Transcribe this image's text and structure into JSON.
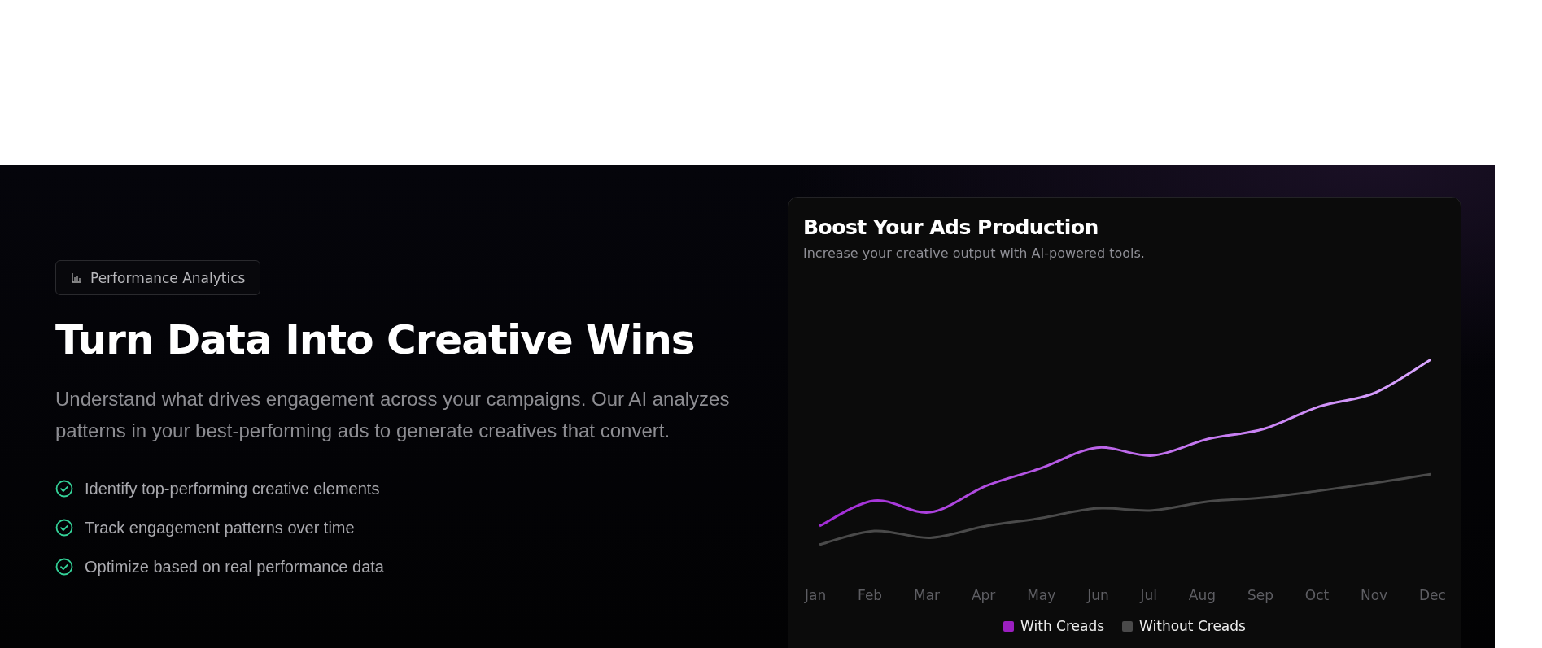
{
  "badge": {
    "label": "Performance Analytics"
  },
  "heading": "Turn Data Into Creative Wins",
  "description": "Understand what drives engagement across your campaigns. Our AI analyzes patterns in your best-performing ads to generate creatives that convert.",
  "features": [
    "Identify top-performing creative elements",
    "Track engagement patterns over time",
    "Optimize based on real performance data"
  ],
  "card": {
    "title": "Boost Your Ads Production",
    "subtitle": "Increase your creative output with AI-powered tools.",
    "months": [
      "Jan",
      "Feb",
      "Mar",
      "Apr",
      "May",
      "Jun",
      "Jul",
      "Aug",
      "Sep",
      "Oct",
      "Nov",
      "Dec"
    ],
    "legend": [
      {
        "label": "With Creads",
        "color": "#9b1fc0"
      },
      {
        "label": "Without Creads",
        "color": "#4a4a4a"
      }
    ]
  }
}
